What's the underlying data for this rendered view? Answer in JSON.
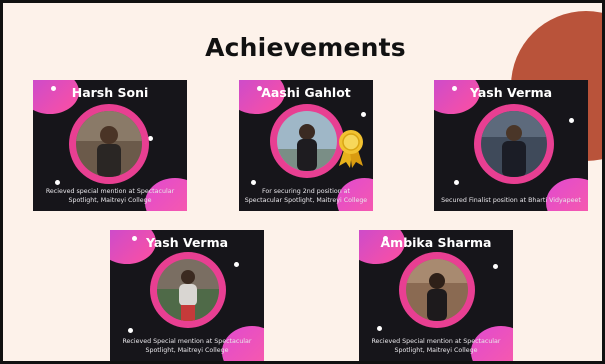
{
  "title": "Achievements",
  "cards": [
    {
      "name": "Harsh Soni",
      "caption": "Recieved special mention at Spectacular Spotlight, Maitreyi College"
    },
    {
      "name": "Aashi Gahlot",
      "caption": "For securing 2nd position at Spectacular Spotlight, Maitreyi College"
    },
    {
      "name": "Yash Verma",
      "caption": "Secured Finalist position at Bharti Vidyapeet"
    },
    {
      "name": "Yash Verma",
      "caption": "Recieved Special mention at Spectacular Spotlight, Maitreyi College"
    },
    {
      "name": "Ambika Sharma",
      "caption": "Recieved Special mention at Spectacular Spotlight, Maitreyi College"
    }
  ],
  "colors": {
    "background": "#fdf2ea",
    "accent_blob": "#b9533a",
    "card": "#16151a",
    "ring": "#e83f92"
  }
}
